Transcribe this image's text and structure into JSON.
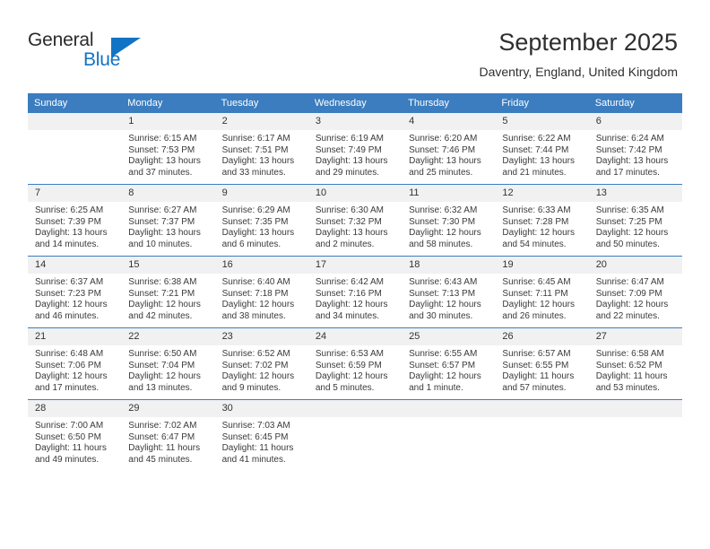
{
  "brand": {
    "name_part1": "General",
    "name_part2": "Blue",
    "triangle_icon": "triangle-icon",
    "accent_color": "#1273c4"
  },
  "header": {
    "title": "September 2025",
    "subtitle": "Daventry, England, United Kingdom"
  },
  "theme": {
    "header_row_bg": "#3b7dbf",
    "daynum_bg": "#f1f1f1",
    "text_color": "#3a3a3a"
  },
  "weekday_headers": [
    "Sunday",
    "Monday",
    "Tuesday",
    "Wednesday",
    "Thursday",
    "Friday",
    "Saturday"
  ],
  "weeks": [
    [
      {
        "day": "",
        "empty": true,
        "sunrise": "",
        "sunset": "",
        "daylight_line1": "",
        "daylight_line2": ""
      },
      {
        "day": "1",
        "sunrise": "Sunrise: 6:15 AM",
        "sunset": "Sunset: 7:53 PM",
        "daylight_line1": "Daylight: 13 hours",
        "daylight_line2": "and 37 minutes."
      },
      {
        "day": "2",
        "sunrise": "Sunrise: 6:17 AM",
        "sunset": "Sunset: 7:51 PM",
        "daylight_line1": "Daylight: 13 hours",
        "daylight_line2": "and 33 minutes."
      },
      {
        "day": "3",
        "sunrise": "Sunrise: 6:19 AM",
        "sunset": "Sunset: 7:49 PM",
        "daylight_line1": "Daylight: 13 hours",
        "daylight_line2": "and 29 minutes."
      },
      {
        "day": "4",
        "sunrise": "Sunrise: 6:20 AM",
        "sunset": "Sunset: 7:46 PM",
        "daylight_line1": "Daylight: 13 hours",
        "daylight_line2": "and 25 minutes."
      },
      {
        "day": "5",
        "sunrise": "Sunrise: 6:22 AM",
        "sunset": "Sunset: 7:44 PM",
        "daylight_line1": "Daylight: 13 hours",
        "daylight_line2": "and 21 minutes."
      },
      {
        "day": "6",
        "sunrise": "Sunrise: 6:24 AM",
        "sunset": "Sunset: 7:42 PM",
        "daylight_line1": "Daylight: 13 hours",
        "daylight_line2": "and 17 minutes."
      }
    ],
    [
      {
        "day": "7",
        "sunrise": "Sunrise: 6:25 AM",
        "sunset": "Sunset: 7:39 PM",
        "daylight_line1": "Daylight: 13 hours",
        "daylight_line2": "and 14 minutes."
      },
      {
        "day": "8",
        "sunrise": "Sunrise: 6:27 AM",
        "sunset": "Sunset: 7:37 PM",
        "daylight_line1": "Daylight: 13 hours",
        "daylight_line2": "and 10 minutes."
      },
      {
        "day": "9",
        "sunrise": "Sunrise: 6:29 AM",
        "sunset": "Sunset: 7:35 PM",
        "daylight_line1": "Daylight: 13 hours",
        "daylight_line2": "and 6 minutes."
      },
      {
        "day": "10",
        "sunrise": "Sunrise: 6:30 AM",
        "sunset": "Sunset: 7:32 PM",
        "daylight_line1": "Daylight: 13 hours",
        "daylight_line2": "and 2 minutes."
      },
      {
        "day": "11",
        "sunrise": "Sunrise: 6:32 AM",
        "sunset": "Sunset: 7:30 PM",
        "daylight_line1": "Daylight: 12 hours",
        "daylight_line2": "and 58 minutes."
      },
      {
        "day": "12",
        "sunrise": "Sunrise: 6:33 AM",
        "sunset": "Sunset: 7:28 PM",
        "daylight_line1": "Daylight: 12 hours",
        "daylight_line2": "and 54 minutes."
      },
      {
        "day": "13",
        "sunrise": "Sunrise: 6:35 AM",
        "sunset": "Sunset: 7:25 PM",
        "daylight_line1": "Daylight: 12 hours",
        "daylight_line2": "and 50 minutes."
      }
    ],
    [
      {
        "day": "14",
        "sunrise": "Sunrise: 6:37 AM",
        "sunset": "Sunset: 7:23 PM",
        "daylight_line1": "Daylight: 12 hours",
        "daylight_line2": "and 46 minutes."
      },
      {
        "day": "15",
        "sunrise": "Sunrise: 6:38 AM",
        "sunset": "Sunset: 7:21 PM",
        "daylight_line1": "Daylight: 12 hours",
        "daylight_line2": "and 42 minutes."
      },
      {
        "day": "16",
        "sunrise": "Sunrise: 6:40 AM",
        "sunset": "Sunset: 7:18 PM",
        "daylight_line1": "Daylight: 12 hours",
        "daylight_line2": "and 38 minutes."
      },
      {
        "day": "17",
        "sunrise": "Sunrise: 6:42 AM",
        "sunset": "Sunset: 7:16 PM",
        "daylight_line1": "Daylight: 12 hours",
        "daylight_line2": "and 34 minutes."
      },
      {
        "day": "18",
        "sunrise": "Sunrise: 6:43 AM",
        "sunset": "Sunset: 7:13 PM",
        "daylight_line1": "Daylight: 12 hours",
        "daylight_line2": "and 30 minutes."
      },
      {
        "day": "19",
        "sunrise": "Sunrise: 6:45 AM",
        "sunset": "Sunset: 7:11 PM",
        "daylight_line1": "Daylight: 12 hours",
        "daylight_line2": "and 26 minutes."
      },
      {
        "day": "20",
        "sunrise": "Sunrise: 6:47 AM",
        "sunset": "Sunset: 7:09 PM",
        "daylight_line1": "Daylight: 12 hours",
        "daylight_line2": "and 22 minutes."
      }
    ],
    [
      {
        "day": "21",
        "sunrise": "Sunrise: 6:48 AM",
        "sunset": "Sunset: 7:06 PM",
        "daylight_line1": "Daylight: 12 hours",
        "daylight_line2": "and 17 minutes."
      },
      {
        "day": "22",
        "sunrise": "Sunrise: 6:50 AM",
        "sunset": "Sunset: 7:04 PM",
        "daylight_line1": "Daylight: 12 hours",
        "daylight_line2": "and 13 minutes."
      },
      {
        "day": "23",
        "sunrise": "Sunrise: 6:52 AM",
        "sunset": "Sunset: 7:02 PM",
        "daylight_line1": "Daylight: 12 hours",
        "daylight_line2": "and 9 minutes."
      },
      {
        "day": "24",
        "sunrise": "Sunrise: 6:53 AM",
        "sunset": "Sunset: 6:59 PM",
        "daylight_line1": "Daylight: 12 hours",
        "daylight_line2": "and 5 minutes."
      },
      {
        "day": "25",
        "sunrise": "Sunrise: 6:55 AM",
        "sunset": "Sunset: 6:57 PM",
        "daylight_line1": "Daylight: 12 hours",
        "daylight_line2": "and 1 minute."
      },
      {
        "day": "26",
        "sunrise": "Sunrise: 6:57 AM",
        "sunset": "Sunset: 6:55 PM",
        "daylight_line1": "Daylight: 11 hours",
        "daylight_line2": "and 57 minutes."
      },
      {
        "day": "27",
        "sunrise": "Sunrise: 6:58 AM",
        "sunset": "Sunset: 6:52 PM",
        "daylight_line1": "Daylight: 11 hours",
        "daylight_line2": "and 53 minutes."
      }
    ],
    [
      {
        "day": "28",
        "sunrise": "Sunrise: 7:00 AM",
        "sunset": "Sunset: 6:50 PM",
        "daylight_line1": "Daylight: 11 hours",
        "daylight_line2": "and 49 minutes."
      },
      {
        "day": "29",
        "sunrise": "Sunrise: 7:02 AM",
        "sunset": "Sunset: 6:47 PM",
        "daylight_line1": "Daylight: 11 hours",
        "daylight_line2": "and 45 minutes."
      },
      {
        "day": "30",
        "sunrise": "Sunrise: 7:03 AM",
        "sunset": "Sunset: 6:45 PM",
        "daylight_line1": "Daylight: 11 hours",
        "daylight_line2": "and 41 minutes."
      },
      {
        "day": "",
        "empty": true,
        "sunrise": "",
        "sunset": "",
        "daylight_line1": "",
        "daylight_line2": ""
      },
      {
        "day": "",
        "empty": true,
        "sunrise": "",
        "sunset": "",
        "daylight_line1": "",
        "daylight_line2": ""
      },
      {
        "day": "",
        "empty": true,
        "sunrise": "",
        "sunset": "",
        "daylight_line1": "",
        "daylight_line2": ""
      },
      {
        "day": "",
        "empty": true,
        "sunrise": "",
        "sunset": "",
        "daylight_line1": "",
        "daylight_line2": ""
      }
    ]
  ]
}
